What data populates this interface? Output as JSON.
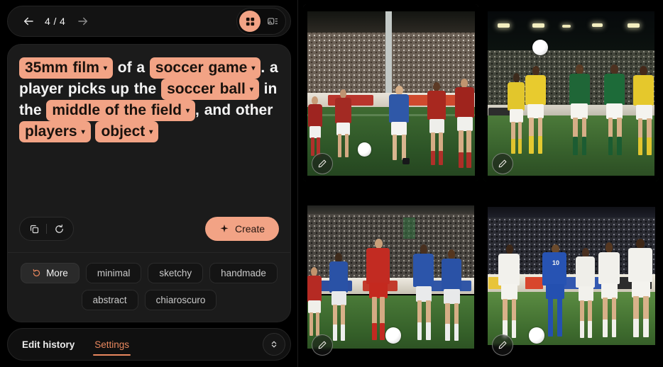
{
  "app": {
    "background": "#000000",
    "accent": "#F2A385",
    "accent_text": "#E8875E",
    "card_bg": "#1b1b1b"
  },
  "topbar": {
    "back_icon": "arrow-left-icon",
    "forward_icon": "arrow-right-icon",
    "counter": "4 / 4",
    "view_toggle": [
      {
        "name": "grid-view",
        "icon": "grid-2x2-icon",
        "active": true
      },
      {
        "name": "detail-view",
        "icon": "image-list-icon",
        "active": false
      }
    ]
  },
  "prompt": {
    "segments": [
      {
        "type": "chip",
        "text": "35mm film"
      },
      {
        "type": "text",
        "text": " of a "
      },
      {
        "type": "chip",
        "text": "soccer game"
      },
      {
        "type": "text",
        "text": ". a player picks up the "
      },
      {
        "type": "chip",
        "text": "soccer ball"
      },
      {
        "type": "text",
        "text": " in the "
      },
      {
        "type": "chip",
        "text": "middle of the field"
      },
      {
        "type": "text",
        "text": ", and other "
      },
      {
        "type": "chip",
        "text": "players"
      },
      {
        "type": "text",
        "text": " "
      },
      {
        "type": "chip",
        "text": "object"
      }
    ],
    "chip_caret": "▾",
    "full_text": "35mm film of a soccer game. a player picks up the soccer ball in the middle of the field, and other players object"
  },
  "actions": {
    "copy_icon": "copy-icon",
    "reset_icon": "refresh-icon",
    "create_label": "Create",
    "create_icon": "sparkle-icon"
  },
  "styles": {
    "more_label": "More",
    "more_icon": "refresh-icon",
    "chips": [
      {
        "label": "minimal"
      },
      {
        "label": "sketchy"
      },
      {
        "label": "handmade"
      },
      {
        "label": "abstract"
      },
      {
        "label": "chiaroscuro"
      }
    ]
  },
  "footer": {
    "tabs": [
      {
        "label": "Edit history",
        "active": false
      },
      {
        "label": "Settings",
        "active": true
      }
    ],
    "expand_icon": "chevron-up-down-icon"
  },
  "results": {
    "edit_icon": "pencil-icon",
    "items": [
      {
        "name": "result-image-1",
        "description": "35mm film photo of a soccer match, blue-shirted player dribbling past red-shirted defenders on green pitch",
        "edit_label": "Edit"
      },
      {
        "name": "result-image-2",
        "description": "35mm film photo of yellow and green teams contesting a high ball under floodlights",
        "edit_label": "Edit"
      },
      {
        "name": "result-image-3",
        "description": "35mm film photo of a red-shirted striker shielding the ball from blue-shirted defenders",
        "edit_label": "Edit"
      },
      {
        "name": "result-image-4",
        "description": "35mm film photo of a blue number 10 player surrounded by white-shirted opponents",
        "edit_label": "Edit"
      }
    ]
  }
}
